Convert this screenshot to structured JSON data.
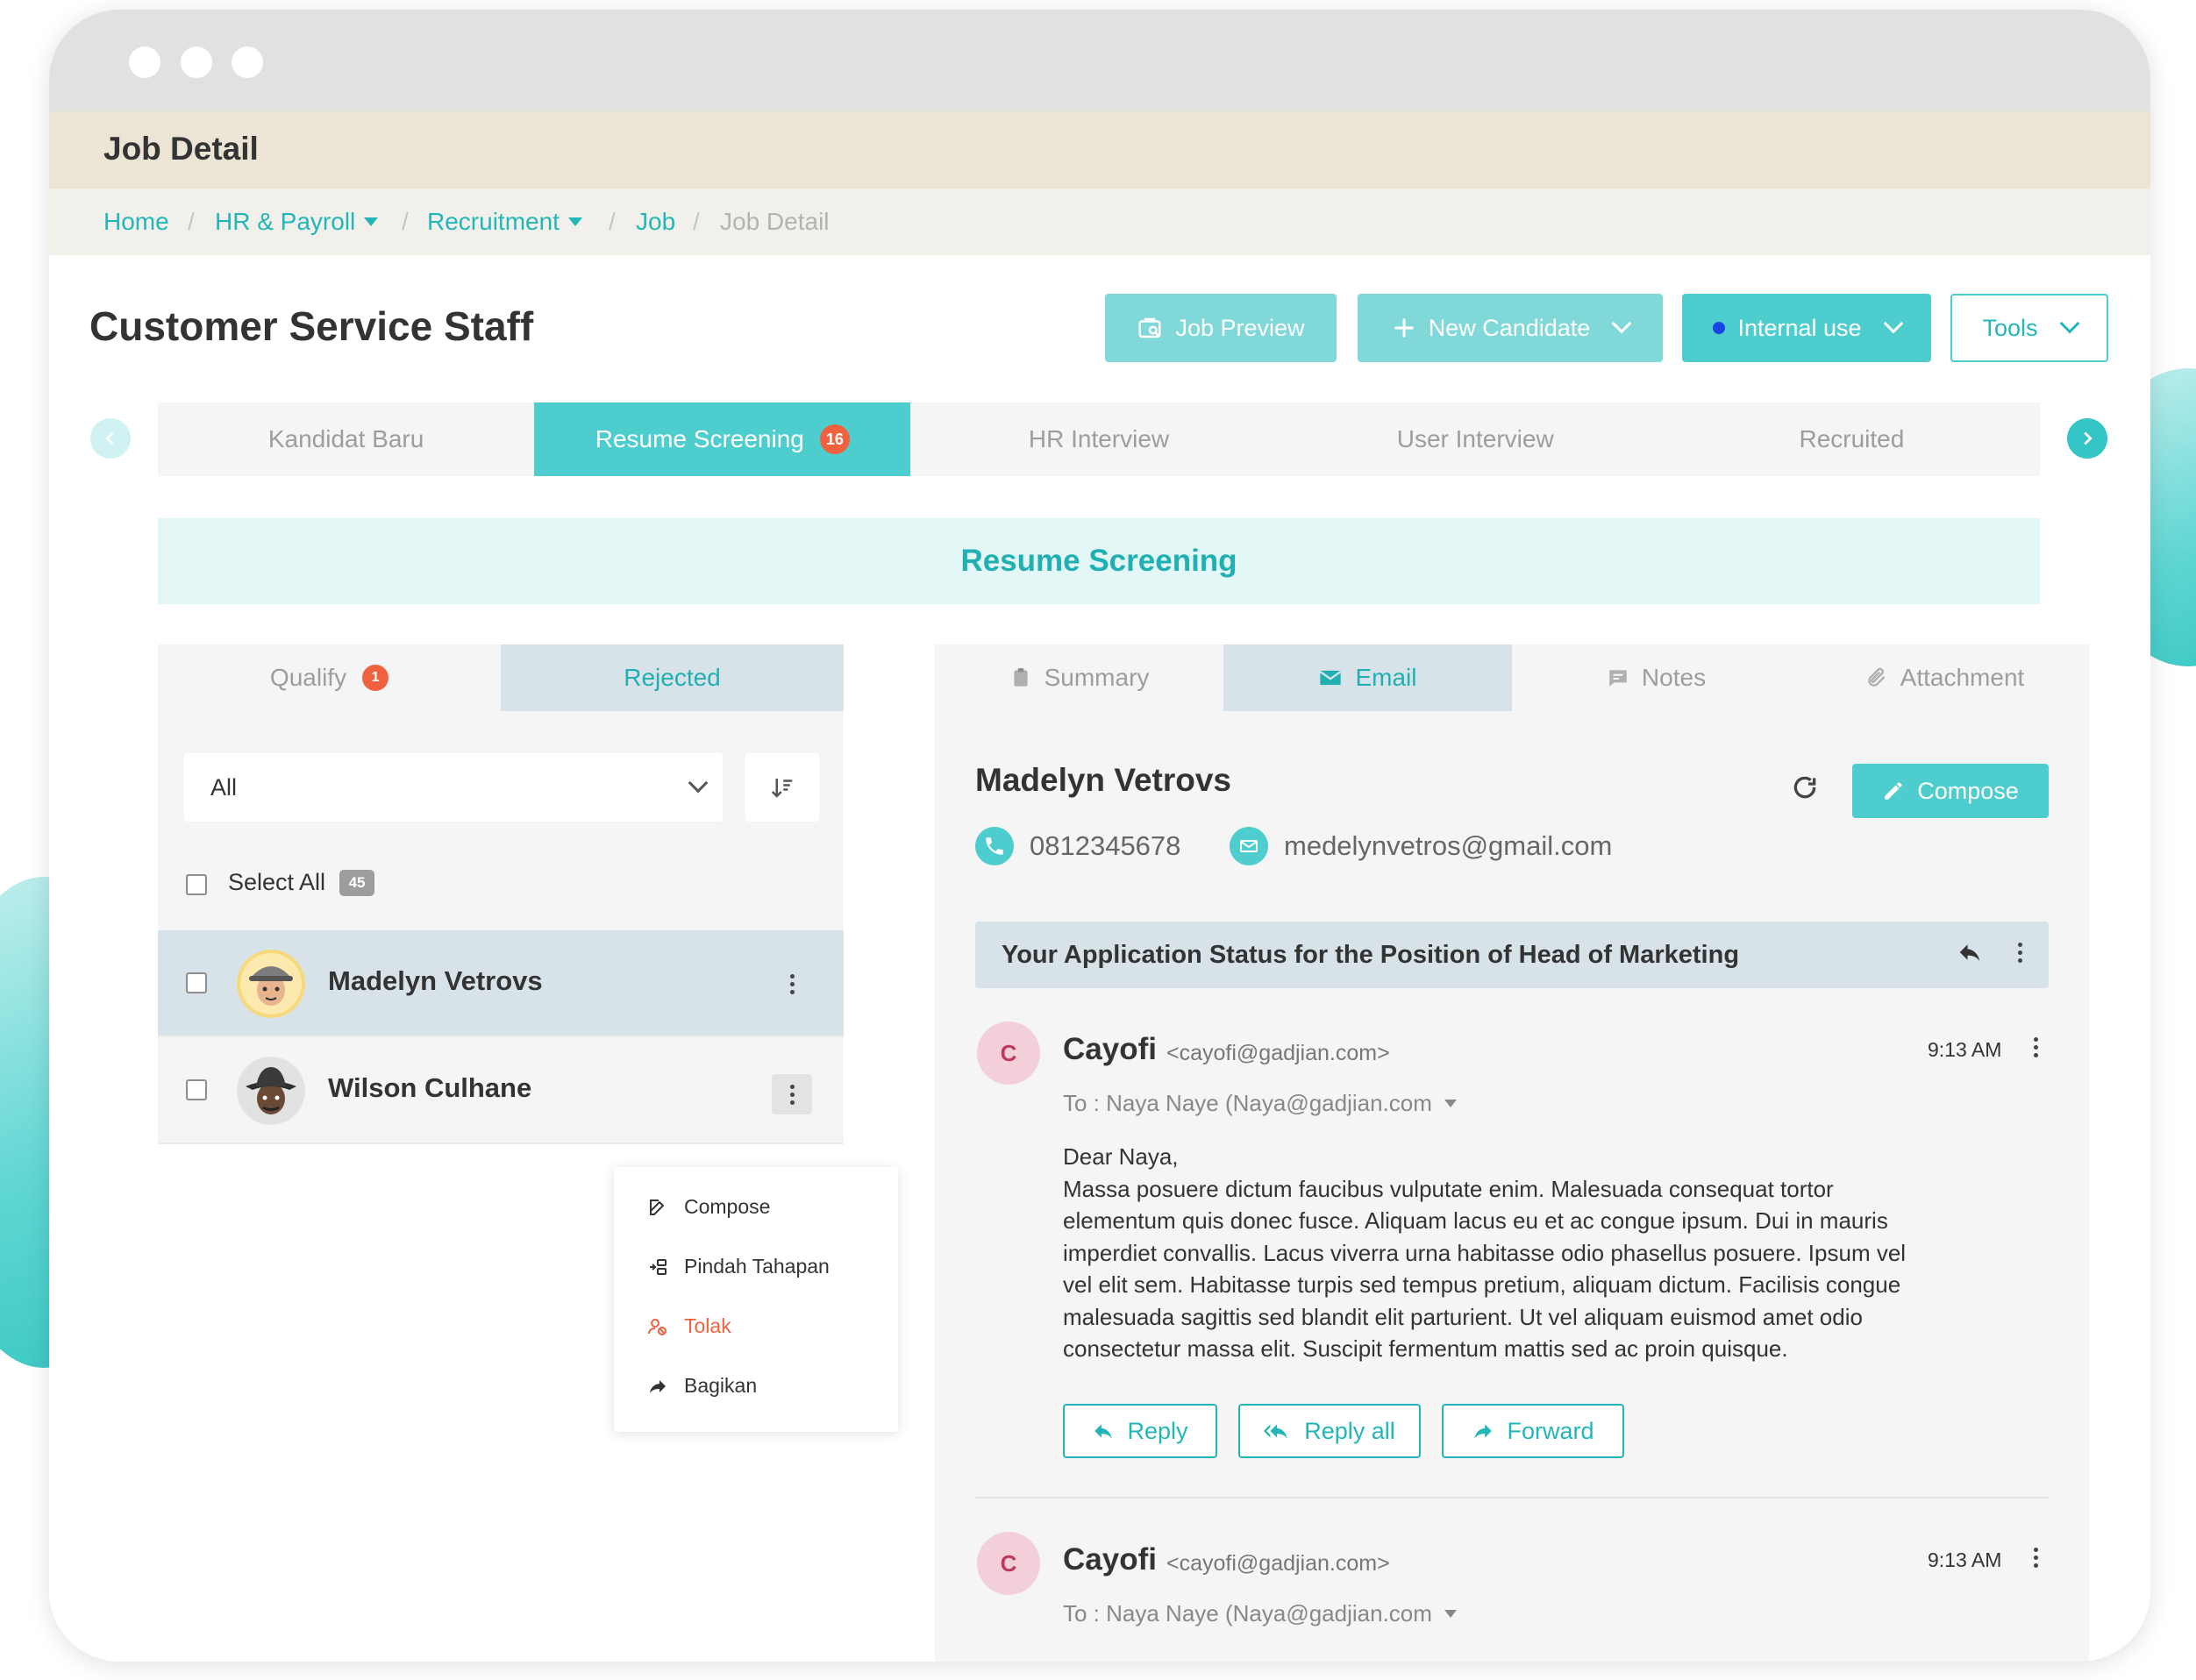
{
  "header": {
    "title": "Job Detail"
  },
  "breadcrumb": {
    "items": [
      "Home",
      "HR & Payroll",
      "Recruitment",
      "Job",
      "Job Detail"
    ],
    "separator": "/"
  },
  "job": {
    "title": "Customer Service Staff"
  },
  "actions": {
    "job_preview": "Job Preview",
    "new_candidate": "New Candidate",
    "internal_use": "Internal use",
    "tools": "Tools"
  },
  "stages": [
    {
      "label": "Kandidat Baru"
    },
    {
      "label": "Resume Screening",
      "count": "16",
      "active": true
    },
    {
      "label": "HR Interview"
    },
    {
      "label": "User Interview"
    },
    {
      "label": "Recruited"
    }
  ],
  "stage_banner": "Resume Screening",
  "candidates_panel": {
    "tabs": [
      {
        "label": "Qualify",
        "count": "1"
      },
      {
        "label": "Rejected",
        "active": true
      }
    ],
    "filter_value": "All",
    "select_all_label": "Select All",
    "total_count": "45",
    "candidates": [
      {
        "name": "Madelyn Vetrovs",
        "selected": true
      },
      {
        "name": "Wilson Culhane"
      }
    ],
    "context_menu": [
      {
        "label": "Compose",
        "icon": "edit-icon"
      },
      {
        "label": "Pindah Tahapan",
        "icon": "move-stage-icon"
      },
      {
        "label": "Tolak",
        "icon": "reject-user-icon",
        "color": "#f0623f"
      },
      {
        "label": "Bagikan",
        "icon": "share-icon"
      }
    ]
  },
  "detail_panel": {
    "tabs": [
      {
        "label": "Summary",
        "icon": "clipboard-icon"
      },
      {
        "label": "Email",
        "icon": "mail-icon",
        "active": true
      },
      {
        "label": "Notes",
        "icon": "notes-icon"
      },
      {
        "label": "Attachment",
        "icon": "paperclip-icon"
      }
    ],
    "contact": {
      "name": "Madelyn Vetrovs",
      "phone": "0812345678",
      "email": "medelynvetros@gmail.com"
    },
    "compose_label": "Compose",
    "thread_subject": "Your Application Status for the Position of Head of Marketing",
    "messages": [
      {
        "initial": "C",
        "sender": "Cayofi",
        "sender_email": "<cayofi@gadjian.com>",
        "time": "9:13 AM",
        "to": "To : Naya Naye  (Naya@gadjian.com",
        "greeting": "Dear Naya,",
        "body": "Massa posuere dictum faucibus vulputate enim. Malesuada consequat tortor elementum quis donec fusce. Aliquam lacus eu et ac congue ipsum. Dui in mauris imperdiet convallis. Lacus viverra urna habitasse odio phasellus posuere. Ipsum vel vel elit sem. Habitasse turpis sed tempus pretium, aliquam dictum. Facilisis congue malesuada sagittis sed blandit elit parturient. Ut vel aliquam euismod amet odio consectetur massa elit. Suscipit fermentum mattis sed ac proin quisque."
      },
      {
        "initial": "C",
        "sender": "Cayofi",
        "sender_email": "<cayofi@gadjian.com>",
        "time": "9:13 AM",
        "to": "To : Naya Naye  (Naya@gadjian.com"
      }
    ],
    "reply_actions": {
      "reply": "Reply",
      "reply_all": "Reply all",
      "forward": "Forward"
    }
  },
  "colors": {
    "accent": "#4ecdcf",
    "accent_text": "#23b6b8",
    "danger": "#f0623f",
    "selected_bg": "#d7e2e9"
  }
}
